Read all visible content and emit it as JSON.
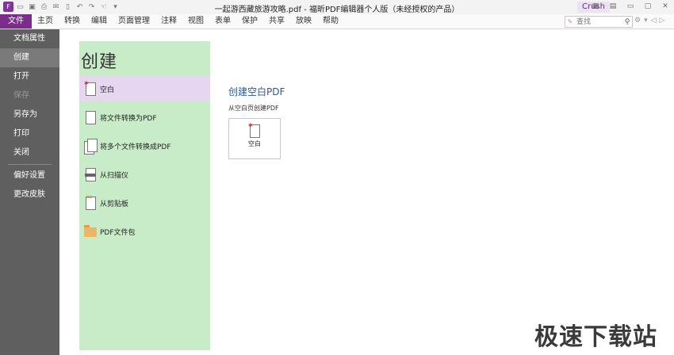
{
  "window": {
    "title": "一起游西藏旅游攻略.pdf - 福昕PDF编辑器个人版（未经授权的产品）",
    "account": "Crush"
  },
  "menu": {
    "items": [
      "文件",
      "主页",
      "转换",
      "编辑",
      "页面管理",
      "注释",
      "视图",
      "表单",
      "保护",
      "共享",
      "放映",
      "帮助"
    ],
    "search_placeholder": "查找"
  },
  "sidebar": {
    "items": [
      {
        "label": "文档属性"
      },
      {
        "label": "创建"
      },
      {
        "label": "打开"
      },
      {
        "label": "保存"
      },
      {
        "label": "另存为"
      },
      {
        "label": "打印"
      },
      {
        "label": "关闭"
      },
      {
        "label": "偏好设置"
      },
      {
        "label": "更改皮肤"
      }
    ]
  },
  "create_panel": {
    "title": "创建",
    "options": [
      {
        "label": "空白",
        "icon": "blank-doc-icon"
      },
      {
        "label": "将文件转换为PDF",
        "icon": "file-convert-icon"
      },
      {
        "label": "将多个文件转换成PDF",
        "icon": "multi-file-convert-icon"
      },
      {
        "label": "从扫描仪",
        "icon": "scanner-icon"
      },
      {
        "label": "从剪贴板",
        "icon": "clipboard-icon"
      },
      {
        "label": "PDF文件包",
        "icon": "folder-icon"
      }
    ]
  },
  "content": {
    "title": "创建空白PDF",
    "subtitle": "从空白页创建PDF",
    "card_label": "空白"
  },
  "watermark": "极速下载站",
  "colors": {
    "accent": "#7b2d8b",
    "sidebar_bg": "#5f5f5f",
    "create_panel_bg": "#c8ecc8",
    "selected_bg": "#e7d6ef"
  }
}
